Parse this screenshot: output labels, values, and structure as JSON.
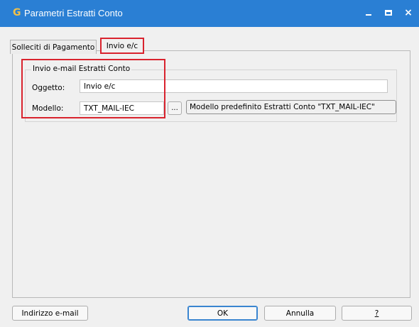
{
  "window": {
    "logo": "G",
    "title": "Parametri Estratti Conto",
    "controls": {
      "minimize": "minimize-icon",
      "maximize": "maximize-icon",
      "close": "×"
    }
  },
  "tabs": [
    {
      "label": "Solleciti di Pagamento",
      "active": false
    },
    {
      "label": "Invio e/c",
      "active": true
    }
  ],
  "email_group": {
    "title": "Invio e-mail Estratti Conto",
    "subject": {
      "label": "Oggetto:",
      "value": "Invio e/c"
    },
    "template": {
      "label": "Modello:",
      "value": "TXT_MAIL-IEC",
      "browse_label": "...",
      "description": "Modello predefinito Estratti Conto \"TXT_MAIL-IEC\""
    }
  },
  "footer": {
    "email_address_button": "Indirizzo e-mail",
    "ok_button": "OK",
    "cancel_button": "Annulla",
    "help_button": "?"
  },
  "colors": {
    "titlebar": "#2a7fd4",
    "highlight": "#d9232e",
    "logo": "#f0c04a"
  }
}
